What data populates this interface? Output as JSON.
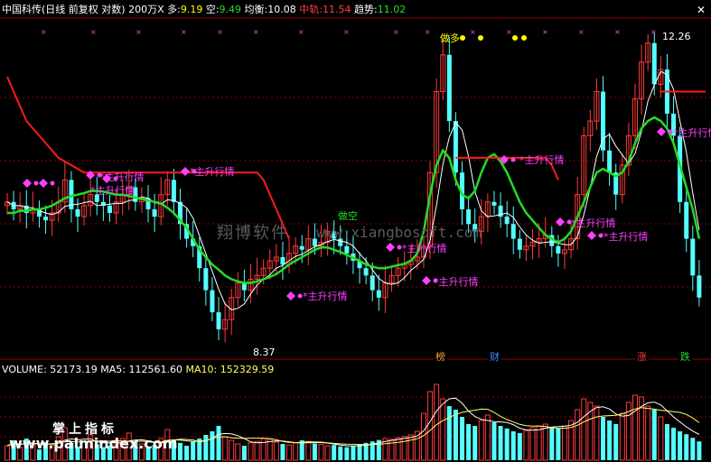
{
  "header": {
    "name": "中国科传",
    "mode": "(日线 前复权 对数)",
    "unit": "200万X",
    "duo_label": "多:",
    "duo_value": "9.19",
    "kong_label": "空:",
    "kong_value": "9.49",
    "junheng_label": "均衡:",
    "junheng_value": "10.08",
    "zhonggui_label": "中轨:",
    "zhonggui_value": "11.54",
    "qushi_label": "趋势:",
    "qushi_value": "11.02"
  },
  "volume_header": {
    "volume_label": "VOLUME:",
    "volume_value": "52173.19",
    "ma5_label": "MA5:",
    "ma5_value": "112561.60",
    "ma10_label": "MA10:",
    "ma10_value": "152329.59"
  },
  "annotations": {
    "high_label": "12.26",
    "low_label": "8.37",
    "signal_text": "*主升行情",
    "kong_signal": "做空",
    "duo_signal": "做多",
    "bang": "榜",
    "cai": "财",
    "zhang": "涨",
    "die": "跌"
  },
  "watermarks": {
    "w1": "翔博软件",
    "w2": "www.xiangbosoft.com",
    "w3": "掌上指标",
    "w4": "www.palmindex.com"
  },
  "colors": {
    "up": "#ff3a3a",
    "down": "#54ffff",
    "mid_track": "#ff1a1a",
    "trend": "#22dd22",
    "signal": "#ff40ff",
    "ma5": "#ffffff",
    "ma10": "#ffff66"
  },
  "chart_data": {
    "type": "candlestick",
    "price_range": [
      8.37,
      12.26
    ],
    "close": [
      10.1,
      10.0,
      10.05,
      9.95,
      10.0,
      9.9,
      9.85,
      9.95,
      10.1,
      10.4,
      10.0,
      9.9,
      10.05,
      10.2,
      10.1,
      10.05,
      9.95,
      10.1,
      10.2,
      10.3,
      10.1,
      10.15,
      10.0,
      9.9,
      10.2,
      10.4,
      10.1,
      9.8,
      9.6,
      9.5,
      9.2,
      8.9,
      8.6,
      8.37,
      8.5,
      8.8,
      9.0,
      8.9,
      9.05,
      9.1,
      9.2,
      9.3,
      9.35,
      9.25,
      9.4,
      9.5,
      9.45,
      9.6,
      9.5,
      9.55,
      9.7,
      9.6,
      9.5,
      9.4,
      9.3,
      9.2,
      9.1,
      8.9,
      8.8,
      9.0,
      9.1,
      9.2,
      9.25,
      9.3,
      9.35,
      9.5,
      10.5,
      11.6,
      12.1,
      11.2,
      10.5,
      10.0,
      9.8,
      9.7,
      9.9,
      10.1,
      10.05,
      9.9,
      9.8,
      9.6,
      9.45,
      9.5,
      9.55,
      9.6,
      9.65,
      9.5,
      9.4,
      9.45,
      9.6,
      10.2,
      11.0,
      11.2,
      11.6,
      10.8,
      10.5,
      10.2,
      10.6,
      11.0,
      11.5,
      12.0,
      12.26,
      11.7,
      11.9,
      11.3,
      11.0,
      10.1,
      9.6,
      9.1,
      8.8
    ],
    "trend_line": [
      9.95,
      9.95,
      9.98,
      9.98,
      10.0,
      10.0,
      10.02,
      10.05,
      10.1,
      10.15,
      10.18,
      10.2,
      10.22,
      10.25,
      10.25,
      10.24,
      10.22,
      10.2,
      10.2,
      10.18,
      10.16,
      10.14,
      10.12,
      10.1,
      10.08,
      10.02,
      9.95,
      9.85,
      9.75,
      9.6,
      9.45,
      9.35,
      9.25,
      9.18,
      9.1,
      9.05,
      9.02,
      9.0,
      9.0,
      9.02,
      9.05,
      9.08,
      9.12,
      9.18,
      9.25,
      9.3,
      9.35,
      9.4,
      9.45,
      9.48,
      9.48,
      9.45,
      9.42,
      9.38,
      9.34,
      9.3,
      9.25,
      9.22,
      9.2,
      9.2,
      9.22,
      9.24,
      9.26,
      9.3,
      9.4,
      9.7,
      10.2,
      10.6,
      10.8,
      10.7,
      10.4,
      10.2,
      10.15,
      10.25,
      10.5,
      10.7,
      10.75,
      10.65,
      10.5,
      10.3,
      10.1,
      9.95,
      9.85,
      9.75,
      9.65,
      9.6,
      9.55,
      9.6,
      9.7,
      9.9,
      10.1,
      10.3,
      10.5,
      10.55,
      10.5,
      10.45,
      10.5,
      10.65,
      10.9,
      11.1,
      11.2,
      11.25,
      11.2,
      11.1,
      10.9,
      10.6,
      10.3,
      10.0,
      9.6
    ],
    "mid_track": [
      11.8,
      11.6,
      11.4,
      11.2,
      11.1,
      11.0,
      10.9,
      10.8,
      10.7,
      10.65,
      10.6,
      10.55,
      10.5,
      10.5,
      10.5,
      10.5,
      10.5,
      10.5,
      10.5,
      10.5,
      10.5,
      10.5,
      10.5,
      10.5,
      10.5,
      10.5,
      10.5,
      10.5,
      10.5,
      10.5,
      10.5,
      10.5,
      10.5,
      10.5,
      10.5,
      10.5,
      10.5,
      10.5,
      10.5,
      10.5,
      10.4,
      10.2,
      10.0,
      9.8,
      9.6,
      null,
      null,
      null,
      null,
      null,
      null,
      null,
      null,
      null,
      null,
      null,
      null,
      null,
      null,
      null,
      null,
      null,
      null,
      null,
      null,
      null,
      null,
      null,
      null,
      null,
      10.7,
      10.7,
      10.7,
      10.7,
      10.7,
      10.7,
      10.7,
      10.7,
      10.7,
      10.7,
      10.7,
      10.7,
      10.7,
      10.7,
      10.7,
      10.6,
      10.4,
      null,
      null,
      null,
      null,
      null,
      null,
      null,
      null,
      null,
      null,
      null,
      null,
      null,
      null,
      null,
      11.6,
      11.6,
      11.6,
      11.6,
      11.6,
      11.6,
      11.6,
      11.6
    ],
    "volume": [
      40,
      55,
      35,
      60,
      45,
      30,
      50,
      42,
      65,
      90,
      48,
      38,
      52,
      70,
      44,
      36,
      40,
      55,
      60,
      75,
      50,
      45,
      38,
      42,
      60,
      85,
      55,
      48,
      40,
      52,
      60,
      70,
      80,
      95,
      65,
      55,
      45,
      40,
      48,
      52,
      60,
      58,
      50,
      45,
      42,
      48,
      55,
      52,
      46,
      44,
      40,
      42,
      38,
      36,
      40,
      44,
      48,
      52,
      56,
      60,
      58,
      62,
      66,
      70,
      80,
      130,
      190,
      210,
      170,
      150,
      140,
      120,
      100,
      95,
      110,
      125,
      105,
      95,
      88,
      80,
      75,
      82,
      90,
      95,
      100,
      92,
      88,
      95,
      110,
      140,
      170,
      160,
      150,
      120,
      110,
      100,
      130,
      160,
      180,
      175,
      150,
      140,
      120,
      100,
      90,
      80,
      72,
      62,
      52
    ],
    "volume_max": 230
  }
}
